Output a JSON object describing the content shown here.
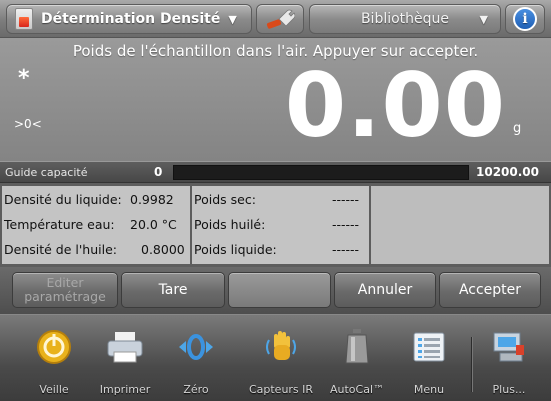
{
  "topbar": {
    "app_name": "Détermination Densité",
    "library_label": "Bibliothèque",
    "info_label": "i",
    "caret": "▼"
  },
  "display": {
    "instruction": "Poids de l'échantillon dans l'air. Appuyer sur accepter.",
    "stability_indicator": "*",
    "zero_indicator": ">0<",
    "weight": "0.00",
    "unit": "g"
  },
  "capacity": {
    "label": "Guide capacité",
    "min": "0",
    "max": "10200.00",
    "fill_fraction": 0,
    "accent": "#4da6ff"
  },
  "info": {
    "col1": [
      {
        "label": "Densité du liquide:",
        "value": "0.9982"
      },
      {
        "label": "Température eau:",
        "value": "20.0 °C"
      },
      {
        "label": "Densité de l'huile:",
        "value": "0.8000"
      }
    ],
    "col2": [
      {
        "label": "Poids sec:",
        "value": "------"
      },
      {
        "label": "Poids huilé:",
        "value": "------"
      },
      {
        "label": "Poids liquide:",
        "value": "------"
      }
    ]
  },
  "softkeys": {
    "edit_line1": "Editer",
    "edit_line2": "paramétrage",
    "tare": "Tare",
    "cancel": "Annuler",
    "accept": "Accepter"
  },
  "nav": [
    {
      "label": "Veille",
      "icon": "standby-icon"
    },
    {
      "label": "Imprimer",
      "icon": "printer-icon"
    },
    {
      "label": "Zéro",
      "icon": "zero-icon"
    },
    {
      "label": "Capteurs IR",
      "icon": "ir-sensor-icon"
    },
    {
      "label": "AutoCal™",
      "icon": "autocal-icon"
    },
    {
      "label": "Menu",
      "icon": "menu-icon"
    },
    {
      "label": "Plus...",
      "icon": "more-icon"
    }
  ]
}
